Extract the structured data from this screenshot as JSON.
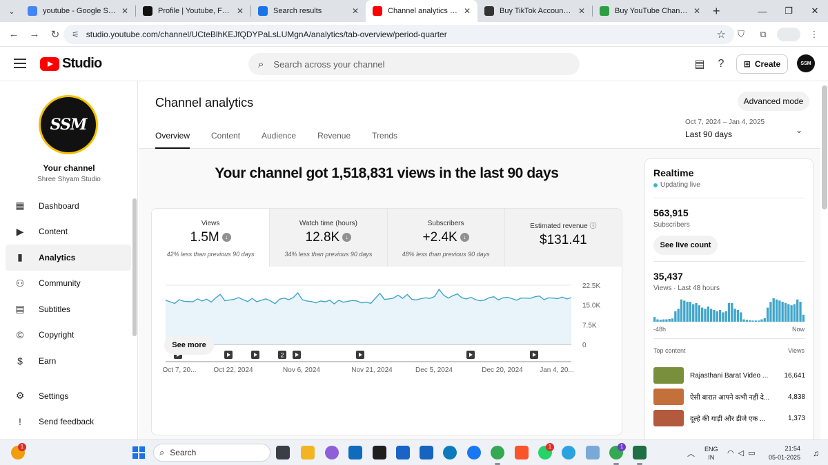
{
  "browser": {
    "tabs": [
      {
        "title": "youtube - Google Search",
        "icon": "google-icon",
        "color": "#4285f4"
      },
      {
        "title": "Profile | Youtube, Facebook",
        "icon": "github-icon",
        "color": "#111111"
      },
      {
        "title": "Search results",
        "icon": "person-icon",
        "color": "#1a73e8"
      },
      {
        "title": "Channel analytics - YouTube",
        "icon": "youtube-icon",
        "color": "#ff0000"
      },
      {
        "title": "Buy TikTok Accounts, Youtu",
        "icon": "diamond-icon",
        "color": "#333333"
      },
      {
        "title": "Buy YouTube Channel | Tru",
        "icon": "shield-icon",
        "color": "#2e9e44"
      }
    ],
    "active_tab": 3,
    "url": "studio.youtube.com/channel/UCteBlhKEJfQDYPaLsLUMgnA/analytics/tab-overview/period-quarter"
  },
  "studio": {
    "brand": "Studio",
    "search_placeholder": "Search across your channel",
    "create_label": "Create",
    "avatar_text": "SSM"
  },
  "sidebar": {
    "avatar_text": "SSM",
    "your_channel": "Your channel",
    "channel_name": "Shree Shyam Studio",
    "items": [
      {
        "label": "Dashboard",
        "icon": "dashboard-icon",
        "glyph": "▦"
      },
      {
        "label": "Content",
        "icon": "content-icon",
        "glyph": "▶"
      },
      {
        "label": "Analytics",
        "icon": "analytics-icon",
        "glyph": "▮"
      },
      {
        "label": "Community",
        "icon": "community-icon",
        "glyph": "⚇"
      },
      {
        "label": "Subtitles",
        "icon": "subtitles-icon",
        "glyph": "▤"
      },
      {
        "label": "Copyright",
        "icon": "copyright-icon",
        "glyph": "©"
      },
      {
        "label": "Earn",
        "icon": "earn-icon",
        "glyph": "$"
      }
    ],
    "active_item": 2,
    "bottom": [
      {
        "label": "Settings",
        "icon": "settings-icon",
        "glyph": "⚙"
      },
      {
        "label": "Send feedback",
        "icon": "feedback-icon",
        "glyph": "!"
      }
    ]
  },
  "analytics": {
    "title": "Channel analytics",
    "advanced_mode": "Advanced mode",
    "tabs": [
      "Overview",
      "Content",
      "Audience",
      "Revenue",
      "Trends"
    ],
    "active_tab": 0,
    "date_range": "Oct 7, 2024 – Jan 4, 2025",
    "period": "Last 90 days",
    "headline": "Your channel got 1,518,831 views in the last 90 days",
    "metrics": [
      {
        "label": "Views",
        "value": "1.5M",
        "trend": "down",
        "comparison": "42% less than previous 90 days"
      },
      {
        "label": "Watch time (hours)",
        "value": "12.8K",
        "trend": "down",
        "comparison": "34% less than previous 90 days"
      },
      {
        "label": "Subscribers",
        "value": "+2.4K",
        "trend": "down",
        "comparison": "48% less than previous 90 days"
      },
      {
        "label": "Estimated revenue",
        "value": "$131.41",
        "trend": "none",
        "comparison": ""
      }
    ],
    "see_more": "See more"
  },
  "chart_data": {
    "type": "area",
    "title": "",
    "xlabel": "",
    "ylabel": "",
    "x_tick_labels": [
      "Oct 7, 20...",
      "Oct 22, 2024",
      "Nov 6, 2024",
      "Nov 21, 2024",
      "Dec 5, 2024",
      "Dec 20, 2024",
      "Jan 4, 20..."
    ],
    "y_tick_labels": [
      "22.5K",
      "15.0K",
      "7.5K",
      "0"
    ],
    "ylim": [
      0,
      22500
    ],
    "grid": true,
    "series": [
      {
        "color": "#41a5c9",
        "values": [
          16800,
          16200,
          15600,
          17000,
          16400,
          16300,
          16200,
          17300,
          16500,
          17200,
          16100,
          17700,
          19000,
          16600,
          16900,
          17100,
          17800,
          17000,
          16300,
          17500,
          16200,
          16800,
          17300,
          16600,
          15500,
          17200,
          17600,
          17000,
          17800,
          19600,
          17000,
          16500,
          16300,
          15800,
          16500,
          16200,
          16800,
          15400,
          16800,
          16000,
          16400,
          16700,
          16500,
          15800,
          16100,
          15600,
          17500,
          19400,
          17100,
          17300,
          17600,
          18700,
          17500,
          19000,
          17200,
          16900,
          17400,
          17700,
          17500,
          18200,
          20900,
          18700,
          17600,
          18500,
          19200,
          17700,
          17300,
          17900,
          17000,
          16600,
          16900,
          17800,
          18100,
          16900,
          17700,
          17900,
          17400,
          16800,
          17600,
          17600,
          17500,
          18100,
          18400,
          17000,
          17700,
          17600,
          17400,
          18000,
          17300,
          17800
        ]
      }
    ],
    "markers": [
      {
        "type": "video",
        "label": ""
      },
      {
        "type": "video",
        "label": ""
      },
      {
        "type": "video",
        "label": ""
      },
      {
        "type": "video",
        "label": "2"
      },
      {
        "type": "video",
        "label": ""
      },
      {
        "type": "short",
        "label": ""
      },
      {
        "type": "video",
        "label": ""
      },
      {
        "type": "video",
        "label": ""
      }
    ]
  },
  "realtime": {
    "title": "Realtime",
    "status": "Updating live",
    "subscribers": "563,915",
    "subscribers_label": "Subscribers",
    "live_count": "See live count",
    "views": "35,437",
    "views_label": "Views · Last 48 hours",
    "bars": [
      0.2,
      0.1,
      0.08,
      0.1,
      0.1,
      0.12,
      0.14,
      0.45,
      0.55,
      0.95,
      0.9,
      0.85,
      0.85,
      0.75,
      0.8,
      0.7,
      0.6,
      0.55,
      0.65,
      0.55,
      0.5,
      0.45,
      0.5,
      0.4,
      0.45,
      0.8,
      0.8,
      0.55,
      0.5,
      0.4,
      0.1,
      0.08,
      0.06,
      0.05,
      0.05,
      0.05,
      0.1,
      0.15,
      0.6,
      0.85,
      1.0,
      0.95,
      0.9,
      0.85,
      0.8,
      0.75,
      0.7,
      0.75,
      0.95,
      0.85,
      0.3
    ],
    "axis_start": "-48h",
    "axis_end": "Now",
    "top_content_label": "Top content",
    "views_col_label": "Views",
    "top_content": [
      {
        "title": "Rajasthani Barat Video ...",
        "views": "16,641"
      },
      {
        "title": "ऐसी बारात आपने कभी नहीं दे...",
        "views": "4,838"
      },
      {
        "title": "दूल्हे की गाड़ी और डीजे एक ...",
        "views": "1,373"
      }
    ]
  },
  "taskbar": {
    "search_label": "Search",
    "lang_1": "ENG",
    "lang_2": "IN",
    "time": "21:54",
    "date": "05-01-2025",
    "weather_badge": "1",
    "whatsapp_badge": "1",
    "chrome2_badge": "1"
  }
}
